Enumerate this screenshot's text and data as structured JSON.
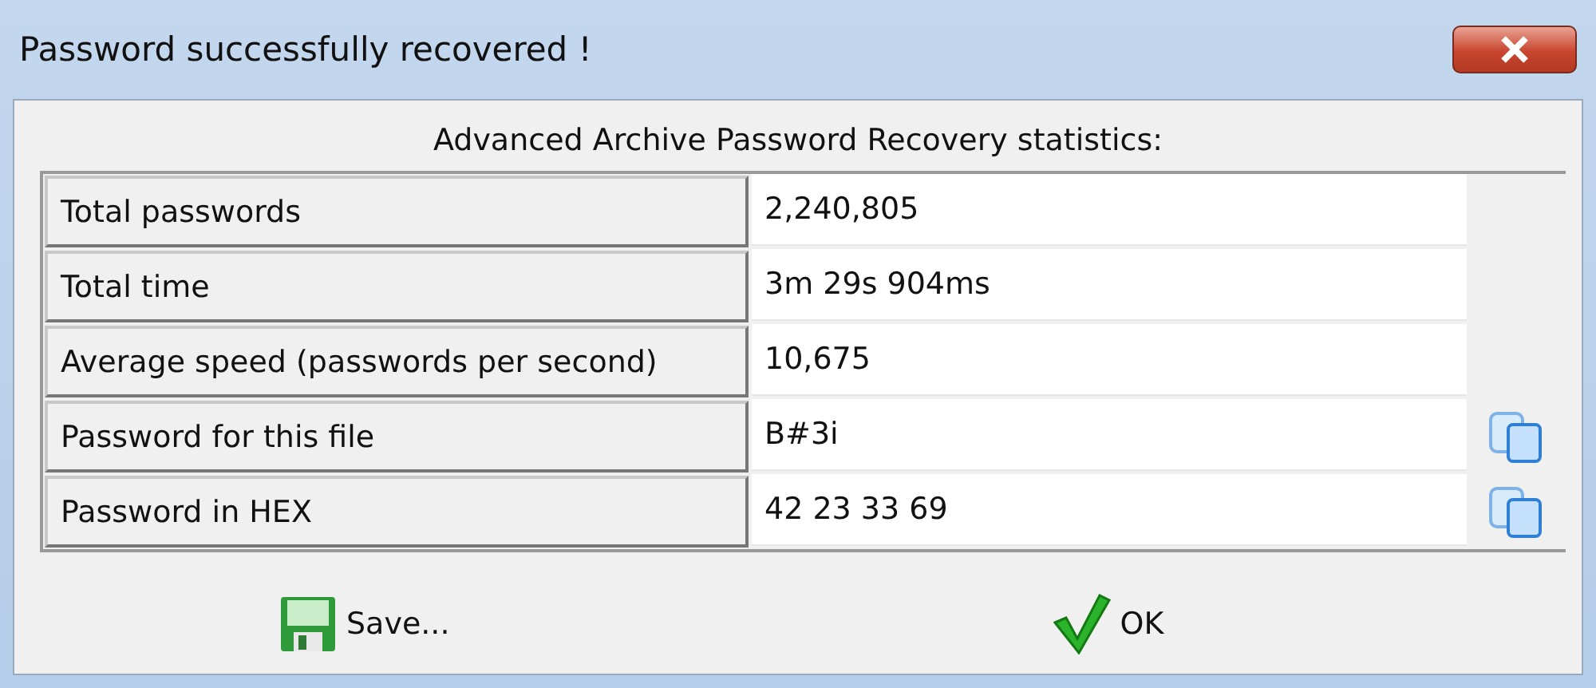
{
  "window": {
    "title": "Password successfully recovered !"
  },
  "heading": "Advanced Archive Password Recovery statistics:",
  "stats": [
    {
      "label": "Total passwords",
      "value": "2,240,805",
      "copyable": false
    },
    {
      "label": "Total time",
      "value": "3m 29s 904ms",
      "copyable": false
    },
    {
      "label": "Average speed (passwords per second)",
      "value": "10,675",
      "copyable": false
    },
    {
      "label": "Password for this file",
      "value": "B#3i",
      "copyable": true
    },
    {
      "label": "Password in HEX",
      "value": "42 23 33 69",
      "copyable": true
    }
  ],
  "buttons": [
    {
      "kind": "save",
      "label": "Save..."
    },
    {
      "kind": "ok",
      "label": "OK"
    }
  ]
}
